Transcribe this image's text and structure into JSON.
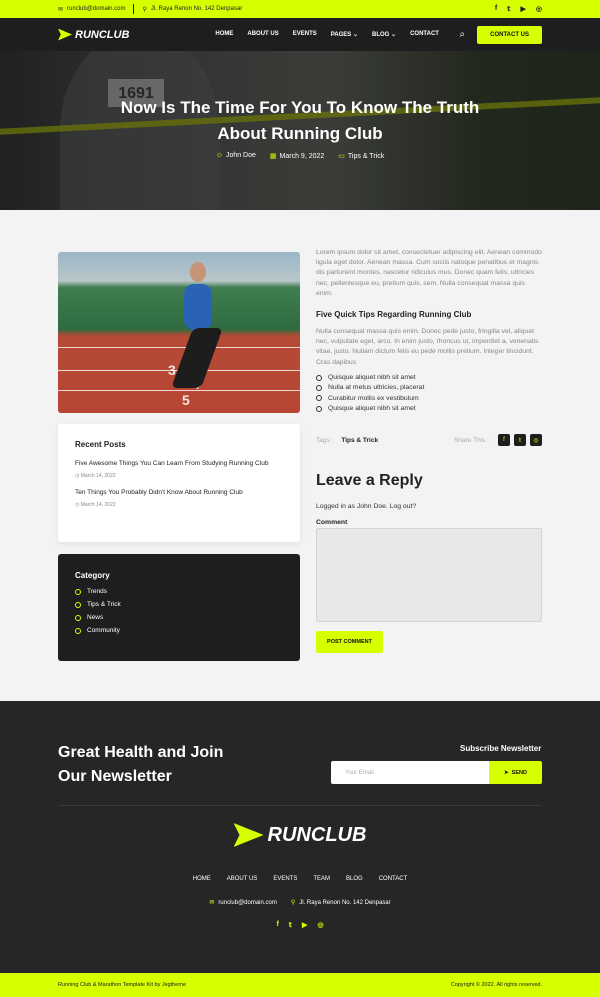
{
  "topbar": {
    "email": "runclub@domain.com",
    "address": "Jl. Raya Renon No. 142 Denpasar",
    "social_icons": [
      "facebook-icon",
      "twitter-icon",
      "youtube-icon",
      "instagram-icon"
    ]
  },
  "nav": {
    "brand": "RUNCLUB",
    "items": [
      "HOME",
      "ABOUT US",
      "EVENTS",
      "PAGES",
      "BLOG",
      "CONTACT"
    ],
    "active": "BLOG",
    "cta": "CONTACT US"
  },
  "hero": {
    "bib_number": "1691",
    "title_line1": "Now Is The Time For You To Know The Truth",
    "title_line2": "About Running Club",
    "author": "John Doe",
    "date": "March 9, 2022",
    "category": "Tips & Trick"
  },
  "photo": {
    "lane_numbers": [
      "3",
      "4",
      "5"
    ]
  },
  "recent_posts": {
    "heading": "Recent Posts",
    "posts": [
      {
        "title": "Five Awesome Things You Can Learn From Studying Running Club",
        "date": "March 14, 2022"
      },
      {
        "title": "Ten Things You Probably Didn't Know About Running Club",
        "date": "March 14, 2022"
      }
    ]
  },
  "category": {
    "heading": "Category",
    "items": [
      "Trends",
      "Tips & Trick",
      "News",
      "Community"
    ]
  },
  "article": {
    "intro": "Lorem ipsum dolor sit amet, consectetuer adipiscing elit. Aenean commodo ligula eget dolor. Aenean massa. Cum sociis natoque penatibus et magnis dis parturient montes, nascetur ridiculus mus. Donec quam felis, ultricies nec, pellentesque eu, pretium quis, sem. Nulla consequat massa quis enim.",
    "subheading": "Five Quick Tips Regarding Running Club",
    "body": "Nulla consequat massa quis enim. Donec pede justo, fringilla vel, aliquet nec, vulputate eget, arcu. In enim justo, rhoncus ut, imperdiet a, venenatis vitae, justo. Nullam dictum felis eu pede mollis pretium. Integer tincidunt. Cras dapibus",
    "checklist": [
      "Quisque aliquet nibh sit amet",
      "Nulla at metus ultricies, placerat",
      "Curabitur mollis ex vestibulum",
      "Quisque aliquet nibh sit amet"
    ],
    "tags_label": "Tags :",
    "tag": "Tips & Trick",
    "share_label": "Share This :"
  },
  "reply": {
    "heading": "Leave a Reply",
    "logged_in": "Logged in as John Doe. Log out?",
    "comment_label": "Comment",
    "button": "POST COMMENT"
  },
  "footer": {
    "headline_line1": "Great Health and Join",
    "headline_line2": "Our Newsletter",
    "subscribe_heading": "Subscribe Newsletter",
    "email_placeholder": "Your Email",
    "send": "SEND",
    "brand": "RUNCLUB",
    "menu": [
      "HOME",
      "ABOUT US",
      "EVENTS",
      "TEAM",
      "BLOG",
      "CONTACT"
    ],
    "email": "runclub@domain.com",
    "address": "Jl. Raya Renon No. 142 Denpasar"
  },
  "bottombar": {
    "left": "Running Club & Marathon Template Kit by Jegtheme",
    "right": "Copyright © 2022. All rights reserved."
  },
  "colors": {
    "accent": "#d6ff00",
    "dark": "#1e1e1e"
  }
}
